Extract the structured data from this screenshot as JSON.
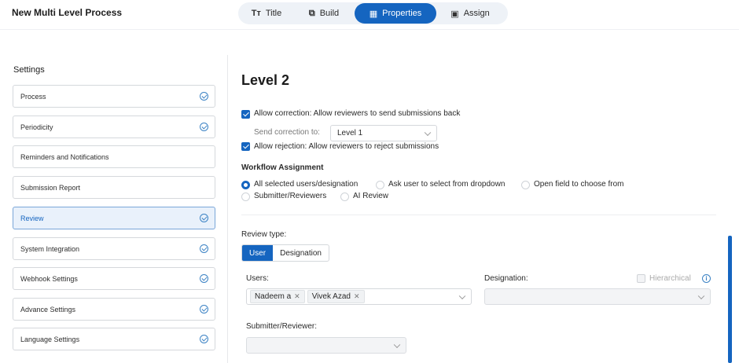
{
  "header": {
    "app_title": "New Multi Level Process",
    "tabs": [
      {
        "label": "Title",
        "icon": "text-format-icon"
      },
      {
        "label": "Build",
        "icon": "build-blocks-icon"
      },
      {
        "label": "Properties",
        "icon": "properties-icon",
        "active": true
      },
      {
        "label": "Assign",
        "icon": "assign-icon"
      }
    ]
  },
  "sidebar": {
    "title": "Settings",
    "items": [
      {
        "label": "Process",
        "checked": true
      },
      {
        "label": "Periodicity",
        "checked": true
      },
      {
        "label": "Reminders and Notifications",
        "checked": false
      },
      {
        "label": "Submission Report",
        "checked": false
      },
      {
        "label": "Review",
        "checked": true,
        "active": true
      },
      {
        "label": "System Integration",
        "checked": true
      },
      {
        "label": "Webhook Settings",
        "checked": true
      },
      {
        "label": "Advance Settings",
        "checked": true
      },
      {
        "label": "Language Settings",
        "checked": true
      }
    ]
  },
  "main": {
    "level_title": "Level 2",
    "allow_correction_label": "Allow correction: Allow reviewers to send submissions back",
    "send_correction_label": "Send correction to:",
    "send_correction_value": "Level 1",
    "allow_rejection_label": "Allow rejection: Allow reviewers to reject submissions",
    "workflow_heading": "Workflow Assignment",
    "workflow_options": [
      "All selected users/designation",
      "Ask user to select from dropdown",
      "Open field to choose from",
      "Submitter/Reviewers",
      "AI Review"
    ],
    "review_type_label": "Review type:",
    "review_type_options": [
      "User",
      "Designation"
    ],
    "users_label": "Users:",
    "users": [
      "Nadeem a",
      "Vivek Azad"
    ],
    "designation_label": "Designation:",
    "hierarchical_label": "Hierarchical",
    "submitter_reviewer_label": "Submitter/Reviewer:"
  },
  "colors": {
    "accent": "#1565c0",
    "active_sidebar_bg": "#e9f1fb"
  }
}
